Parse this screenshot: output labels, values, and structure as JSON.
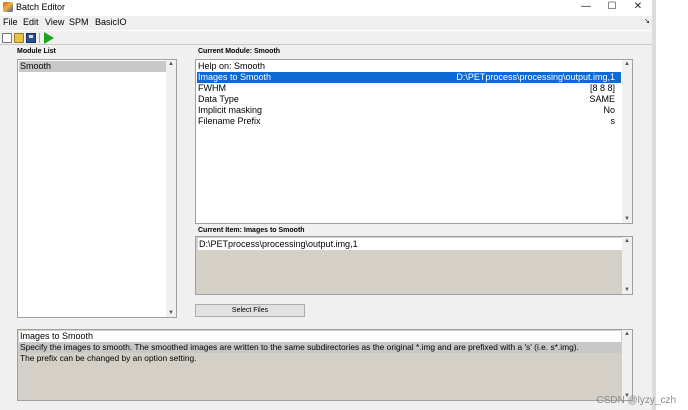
{
  "window": {
    "title": "Batch Editor",
    "controls": {
      "minimize": "—",
      "maximize": "☐",
      "close": "✕"
    }
  },
  "menubar": {
    "items": [
      "File",
      "Edit",
      "View",
      "SPM",
      "BasicIO"
    ],
    "overflow_icon": "arrow-icon",
    "overflow_glyph": "↘"
  },
  "toolbar": {
    "icons": [
      "new-file-icon",
      "open-folder-icon",
      "save-icon",
      "run-icon"
    ]
  },
  "module_list": {
    "label": "Module List",
    "items": [
      "Smooth"
    ],
    "selected_index": 0
  },
  "current_module": {
    "label": "Current Module: Smooth",
    "rows": [
      {
        "name": "Help on: Smooth",
        "value": ""
      },
      {
        "name": "Images to Smooth",
        "value": "D:\\PETprocess\\processing\\output.img,1"
      },
      {
        "name": "FWHM",
        "value": "[8 8 8]"
      },
      {
        "name": "Data Type",
        "value": "SAME"
      },
      {
        "name": "Implicit masking",
        "value": "No"
      },
      {
        "name": "Filename Prefix",
        "value": "s"
      }
    ],
    "selected_index": 1
  },
  "current_item": {
    "label": "Current Item: Images to Smooth",
    "value": "D:\\PETprocess\\processing\\output.img,1"
  },
  "select_files_button": "Select Files",
  "help": {
    "title": "Images to Smooth",
    "lines": [
      "Specify  the  images to smooth. The smoothed images are written to the same subdirectories as the original *.img and are prefixed with a 's' (i.e. s*.img).",
      "The prefix can be changed by an option setting."
    ]
  },
  "scrollbar": {
    "up_glyph": "▲",
    "down_glyph": "▼"
  },
  "watermark": "CSDN @lyzy_czh",
  "colors": {
    "selection": "#0a6ad6",
    "panel_bg": "#f0f0f0",
    "readonly_bg": "#d4d0c8",
    "run_icon": "#1aa51a"
  }
}
